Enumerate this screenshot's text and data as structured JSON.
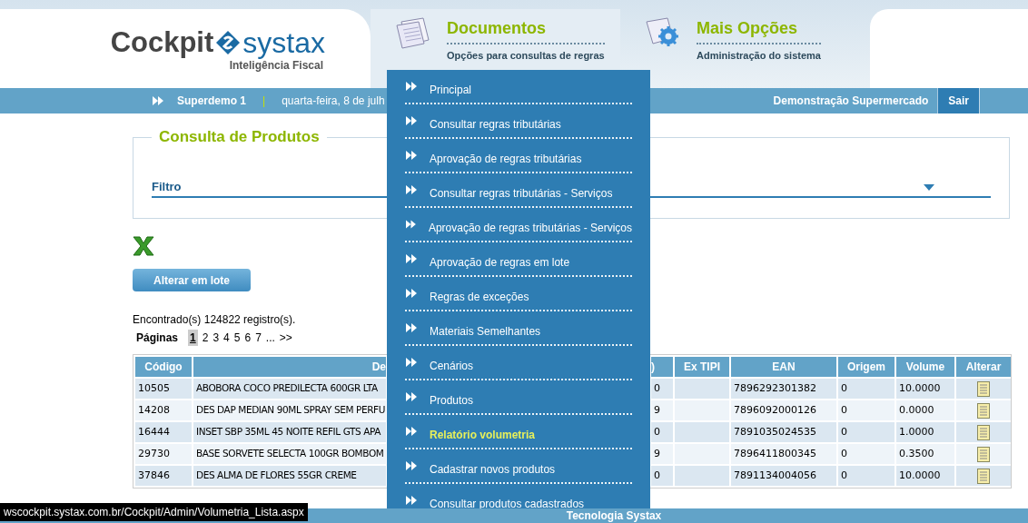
{
  "logo": {
    "brand": "Cockpit",
    "name": "systax",
    "tagline": "Inteligência Fiscal"
  },
  "nav_tabs": [
    {
      "title": "Documentos",
      "subtitle": "Opções para consultas de regras",
      "kind": "documents",
      "selected": true
    },
    {
      "title": "Mais Opções",
      "subtitle": "Administração do sistema",
      "kind": "gear",
      "selected": false
    }
  ],
  "top_bar": {
    "user": "Superdemo 1",
    "separator": "|",
    "date": "quarta-feira, 8 de julh",
    "company": "Demonstração Supermercado",
    "logout": "Sair"
  },
  "menu": [
    {
      "label": "Principal",
      "selected": false
    },
    {
      "label": "Consultar regras tributárias",
      "selected": false
    },
    {
      "label": "Aprovação de regras tributárias",
      "selected": false
    },
    {
      "label": "Consultar regras tributárias - Serviços",
      "selected": false
    },
    {
      "label": "Aprovação de regras tributárias - Serviços",
      "selected": false
    },
    {
      "label": "Aprovação de regras em lote",
      "selected": false
    },
    {
      "label": "Regras de exceções",
      "selected": false
    },
    {
      "label": "Materiais Semelhantes",
      "selected": false
    },
    {
      "label": "Cenários",
      "selected": false
    },
    {
      "label": "Produtos",
      "selected": false
    },
    {
      "label": "Relatório volumetria",
      "selected": true
    },
    {
      "label": "Cadastrar novos produtos",
      "selected": false
    },
    {
      "label": "Consultar produtos cadastrados",
      "selected": false
    }
  ],
  "panel": {
    "title": "Consulta de Produtos",
    "filter_label": "Filtro"
  },
  "batch_button": "Alterar em lote",
  "results": "Encontrado(s) 124822 registro(s).",
  "pagination": {
    "label": "Páginas",
    "pages": [
      {
        "label": "1",
        "selected": true
      },
      {
        "label": "2",
        "selected": false
      },
      {
        "label": "3",
        "selected": false
      },
      {
        "label": "4",
        "selected": false
      },
      {
        "label": "5",
        "selected": false
      },
      {
        "label": "6",
        "selected": false
      },
      {
        "label": "7",
        "selected": false
      },
      {
        "label": "...",
        "selected": false
      },
      {
        "label": ">>",
        "selected": false
      }
    ]
  },
  "table": {
    "columns": [
      "Código",
      "De",
      ")",
      "Ex TIPI",
      "EAN",
      "Origem",
      "Volume",
      "Alterar"
    ],
    "rows": [
      [
        "10505",
        "ABOBORA COCO PREDILECTA 600GR LTA",
        "0",
        "",
        "7896292301382",
        "0",
        "10.0000"
      ],
      [
        "14208",
        "DES DAP MEDIAN 90ML SPRAY SEM PERFU",
        "9",
        "",
        "7896092000126",
        "0",
        "0.0000"
      ],
      [
        "16444",
        "INSET SBP 35ML 45 NOITE REFIL GTS APA",
        "0",
        "",
        "7891035024535",
        "0",
        "1.0000"
      ],
      [
        "29730",
        "BASE SORVETE SELECTA 100GR BOMBOM",
        "9",
        "",
        "7896411800345",
        "0",
        "0.3500"
      ],
      [
        "37846",
        "DES ALMA DE FLORES 55GR CREME",
        "0",
        "",
        "7891134004056",
        "0",
        "10.0000"
      ]
    ]
  },
  "footer": "Tecnologia Systax",
  "status_url": "wscockpit.systax.com.br/Cockpit/Admin/Volumetria_Lista.aspx"
}
